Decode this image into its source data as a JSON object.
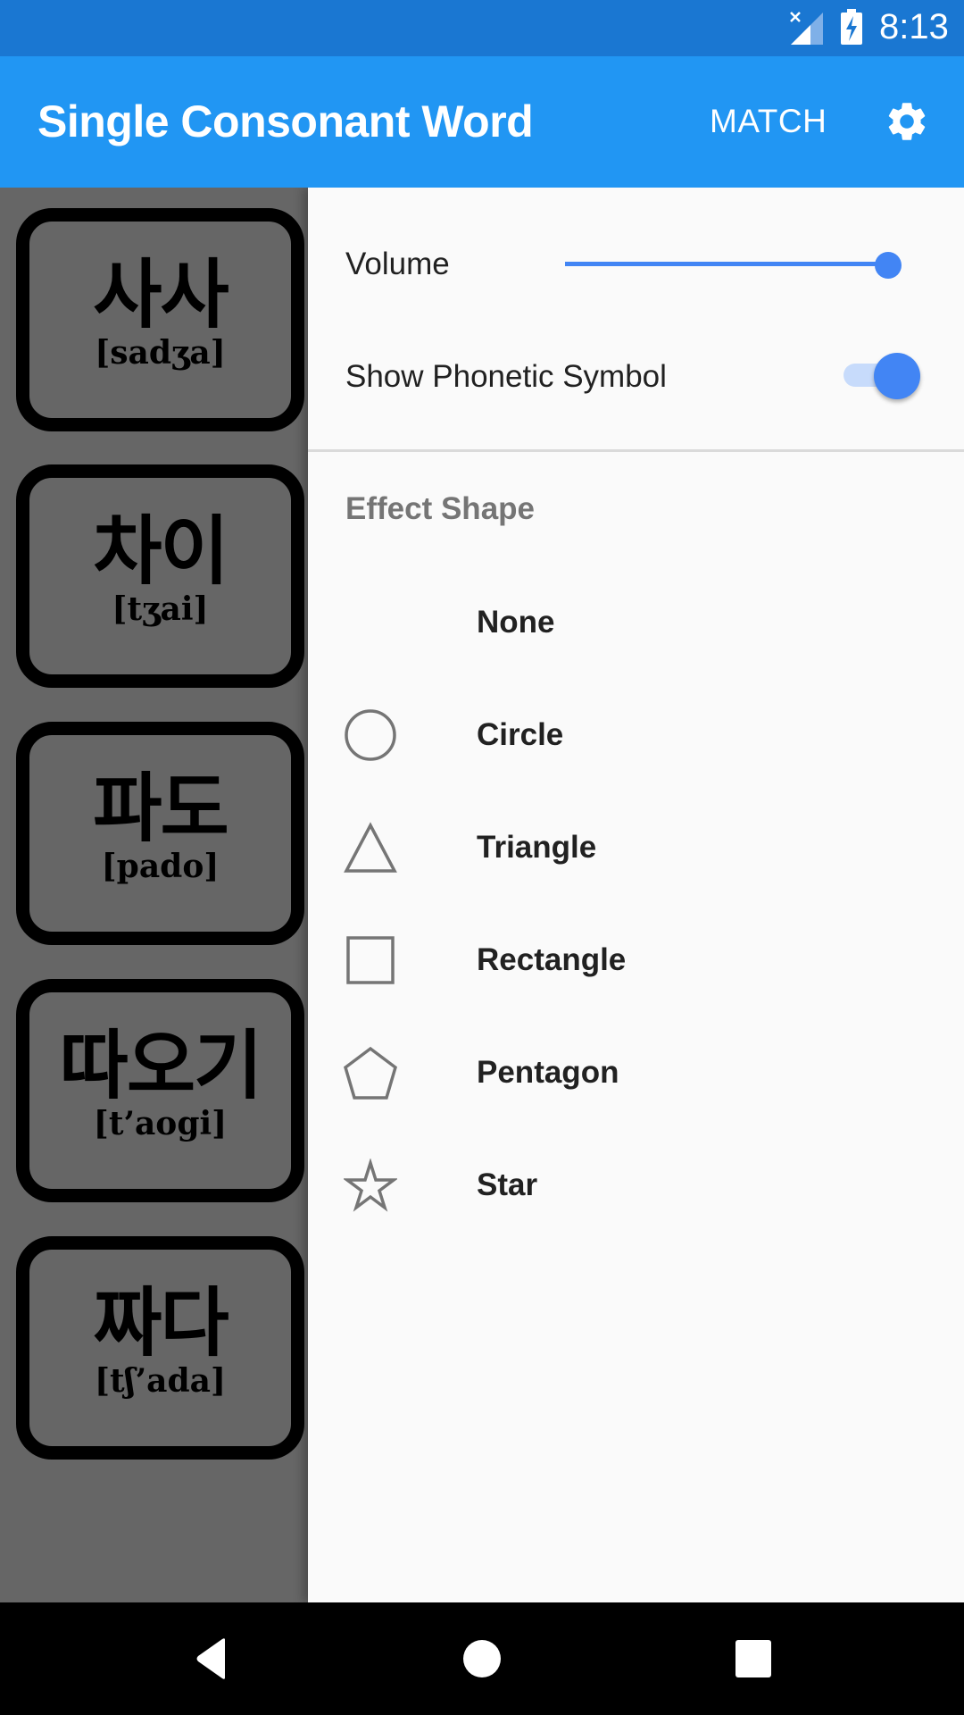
{
  "status_bar": {
    "time": "8:13",
    "signal_icon": "signal-no-sim-icon",
    "battery_icon": "battery-charging-icon"
  },
  "app_bar": {
    "title": "Single Consonant Word",
    "match_label": "MATCH",
    "settings_icon": "gear-icon"
  },
  "colors": {
    "status_bar": "#1A77D2",
    "app_bar": "#2196F3",
    "accent": "#4285F4",
    "panel_bg": "#FAFAFA",
    "scrim": "#666666"
  },
  "word_cards": [
    {
      "word": "사사",
      "phonetic": "[sadʒa]"
    },
    {
      "word": "차이",
      "phonetic": "[tʒai]"
    },
    {
      "word": "파도",
      "phonetic": "[pado]"
    },
    {
      "word": "따오기",
      "phonetic": "[t’aogi]"
    },
    {
      "word": "짜다",
      "phonetic": "[tʃ’ada]"
    }
  ],
  "settings": {
    "volume_label": "Volume",
    "volume_value": 1.0,
    "phonetic_label": "Show Phonetic Symbol",
    "phonetic_enabled": true,
    "effect_shape_title": "Effect Shape",
    "shapes": [
      {
        "label": "None",
        "icon": "none"
      },
      {
        "label": "Circle",
        "icon": "circle-icon"
      },
      {
        "label": "Triangle",
        "icon": "triangle-icon"
      },
      {
        "label": "Rectangle",
        "icon": "rectangle-icon"
      },
      {
        "label": "Pentagon",
        "icon": "pentagon-icon"
      },
      {
        "label": "Star",
        "icon": "star-icon"
      }
    ]
  },
  "nav_bar": {
    "back_icon": "back-icon",
    "home_icon": "home-icon",
    "recents_icon": "recents-icon"
  }
}
